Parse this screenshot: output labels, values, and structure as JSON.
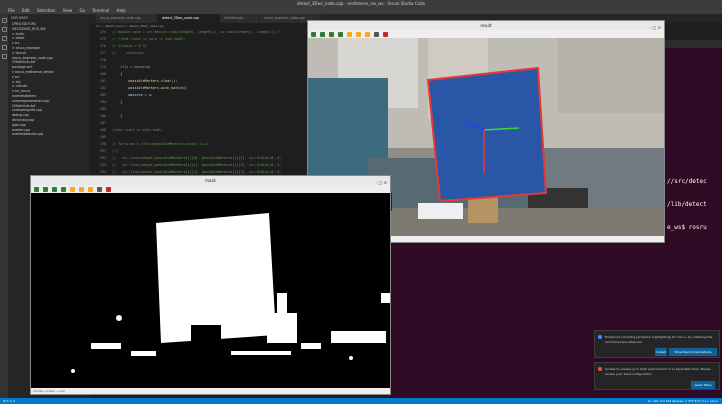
{
  "window": {
    "title": "detect_3Dwc_node.cpp - meltsense_ros_ws - Visual Studio Code"
  },
  "menu": [
    "File",
    "Edit",
    "Selection",
    "View",
    "Go",
    "Terminal",
    "Help"
  ],
  "explorer": {
    "header": "EXPLORER",
    "items": [
      {
        "label": "OPEN EDITORS",
        "sel": false
      },
      {
        "label": "MELTSENSE_ROS_WS",
        "sel": false
      },
      {
        "label": "> build",
        "sel": false
      },
      {
        "label": "> devel",
        "sel": false
      },
      {
        "label": "v src",
        "sel": false
      },
      {
        "label": "  > aruco_example",
        "sel": false
      },
      {
        "label": "    > launch",
        "sel": false
      },
      {
        "label": "    aruco_example_node.cpp",
        "sel": false
      },
      {
        "label": "    CMakeLists.txt",
        "sel": false
      },
      {
        "label": "    package.xml",
        "sel": false
      },
      {
        "label": "  v aruco_meltsense_detect",
        "sel": false
      },
      {
        "label": "    v src",
        "sel": false
      },
      {
        "label": "      > cfg",
        "sel": false
      },
      {
        "label": "      > include",
        "sel": false
      },
      {
        "label": "      v src_aruco",
        "sel": false
      },
      {
        "label": "        markerlabelers",
        "sel": false
      },
      {
        "label": "        cameraparameters.cpp",
        "sel": false
      },
      {
        "label": "        CMakeLists.txt",
        "sel": false
      },
      {
        "label": "        cvdrawingutils.cpp",
        "sel": false
      },
      {
        "label": "        debug.cpp",
        "sel": false
      },
      {
        "label": "        dictionary.cpp",
        "sel": false
      },
      {
        "label": "        ippe.cpp",
        "sel": false
      },
      {
        "label": "        marker.cpp",
        "sel": false
      },
      {
        "label": "        markerdetector.cpp",
        "sel": false
      }
    ]
  },
  "tabs": [
    {
      "label": "aruco_example_node.cpp",
      "active": false
    },
    {
      "label": "detect_3Dwc_node.cpp",
      "active": true
    },
    {
      "label": "Untitled.cpp",
      "active": false
    },
    {
      "label": "aruco_example_node.cpp",
      "active": false
    }
  ],
  "breadcrumb": "src > detect_aruco > detect_3Dwc_node.cpp",
  "code": [
    {
      "n": "174",
      "t": "// double cole = cv::min(cv::min(length), length()), cv::min(length(), length()) /",
      "c": "c-comment"
    },
    {
      "n": "175",
      "t": "// //std::cout << cole << std::endl;",
      "c": "c-comment"
    },
    {
      "n": "176",
      "t": "// if(cole < 0.3)",
      "c": "c-comment"
    },
    {
      "n": "177",
      "t": "//     continue;",
      "c": "c-comment"
    },
    {
      "n": "178",
      "t": "",
      "c": "c-plain"
    },
    {
      "n": "179",
      "t": "    if(s > maxarea)",
      "c": "c-kw"
    },
    {
      "n": "180",
      "t": "    {",
      "c": "c-plain"
    },
    {
      "n": "181",
      "t": "        possibleMarkers.clear();",
      "c": "c-fn"
    },
    {
      "n": "182",
      "t": "        possibleMarkers.push_back(m);",
      "c": "c-fn"
    },
    {
      "n": "183",
      "t": "        maxarea = s;",
      "c": "c-var"
    },
    {
      "n": "184",
      "t": "    }",
      "c": "c-plain"
    },
    {
      "n": "185",
      "t": "",
      "c": "c-plain"
    },
    {
      "n": "186",
      "t": "    }",
      "c": "c-plain"
    },
    {
      "n": "187",
      "t": "",
      "c": "c-plain"
    },
    {
      "n": "188",
      "t": "//std::cout << std::endl;",
      "c": "c-comment"
    },
    {
      "n": "189",
      "t": "",
      "c": "c-plain"
    },
    {
      "n": "190",
      "t": "// for(size_t i=0;i<possibleMarkers.size();i++)",
      "c": "c-comment"
    },
    {
      "n": "191",
      "t": "//{",
      "c": "c-comment"
    },
    {
      "n": "192",
      "t": "//   cv::line(output,possibleMarkers[i][0], possibleMarkers[i][1], cv::Scalar(0, 0,",
      "c": "c-comment"
    },
    {
      "n": "193",
      "t": "//   cv::line(output,possibleMarkers[i][1], possibleMarkers[i][2], cv::Scalar(0, 0,",
      "c": "c-comment"
    },
    {
      "n": "194",
      "t": "//   cv::line(output,possibleMarkers[i][2], possibleMarkers[i][3], cv::Scalar(0, 0,",
      "c": "c-comment"
    }
  ],
  "terminal_lines": [
    "//src/detec",
    "/lib/detect",
    "e_ws$ rosru"
  ],
  "win_color": {
    "title": "result",
    "status": "(x=xxx, y=xxx) ~ R:xx G:xx B:xx"
  },
  "win_bw": {
    "title": "mask",
    "status": "(x=xxx, y=xxx) ~ L:xx"
  },
  "notif1": {
    "text": "Enhanced colorizing (semantic highlighting) for C/C++ by installing the recommended extension.",
    "btn1": "Install",
    "btn2": "Show Recommendations"
  },
  "notif2": {
    "text": "Unable to resolve your shell environment in a reasonable time. Please review your shell configuration.",
    "btn1": "Learn More"
  },
  "status": {
    "left": "⊗ 0 ⚠ 0",
    "right": "Ln 143, Col 104   Spaces: 4   UTF-8   LF   C++   Linux"
  },
  "colors": {
    "accent": "#007acc",
    "marker_outline": "#e53935",
    "marker_fill": "#2a56a8"
  }
}
